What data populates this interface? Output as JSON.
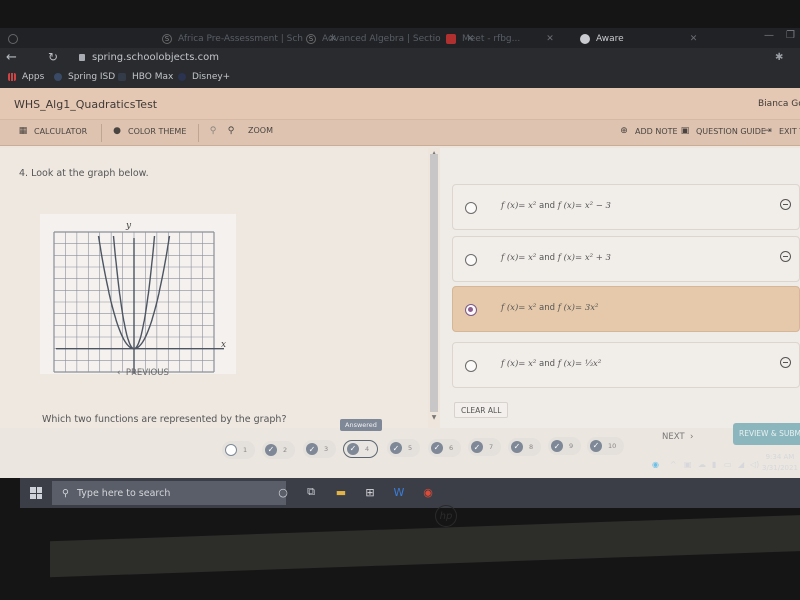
{
  "browser": {
    "tabs": [
      {
        "label": "Africa Pre-Assessment | Sch",
        "icon": "schoolobjects-icon",
        "active": false
      },
      {
        "label": "Advanced Algebra | Sectio",
        "icon": "schoolobjects-icon",
        "active": false
      },
      {
        "label": "Meet - rfbg...",
        "icon": "meet-icon",
        "active": false
      },
      {
        "label": "Aware",
        "icon": "globe-icon",
        "active": true
      }
    ],
    "url": "spring.schoolobjects.com",
    "bookmarks": [
      {
        "label": "Apps",
        "icon": "apps-grid-icon"
      },
      {
        "label": "Spring ISD",
        "icon": "bookmark-icon"
      },
      {
        "label": "HBO Max",
        "icon": "hbo-icon"
      },
      {
        "label": "Disney+",
        "icon": "disney-icon"
      }
    ]
  },
  "app": {
    "title": "WHS_Alg1_QuadraticsTest",
    "user": "Bianca Gon",
    "toolbar": {
      "calculator": "CALCULATOR",
      "color_theme": "COLOR THEME",
      "zoom": "ZOOM",
      "add_note": "ADD NOTE",
      "question_guide": "QUESTION GUIDE",
      "exit": "EXIT T"
    }
  },
  "question": {
    "title": "4. Look at the graph below.",
    "prompt": "Which two functions are represented by the graph?",
    "graph": {
      "x_label": "x",
      "y_label": "y"
    },
    "options": [
      {
        "f1": "f (x)= x²",
        "and": "and",
        "f2": "f (x)= x² − 3",
        "selected": false
      },
      {
        "f1": "f (x)= x²",
        "and": "and",
        "f2": "f (x)= x² + 3",
        "selected": false
      },
      {
        "f1": "f (x)= x²",
        "and": "and",
        "f2": "f (x)= 3x²",
        "selected": true
      },
      {
        "f1": "f (x)= x²",
        "and": "and",
        "f2": "f (x)= ⅓x²",
        "selected": false
      }
    ],
    "clear_all": "CLEAR ALL"
  },
  "navigation": {
    "previous": "PREVIOUS",
    "next": "NEXT",
    "review_submit": "REVIEW & SUBMI",
    "tooltip": "Answered",
    "current_question": 4,
    "questions": [
      {
        "n": "1",
        "answered": false
      },
      {
        "n": "2",
        "answered": true
      },
      {
        "n": "3",
        "answered": true
      },
      {
        "n": "4",
        "answered": true
      },
      {
        "n": "5",
        "answered": true
      },
      {
        "n": "6",
        "answered": true
      },
      {
        "n": "7",
        "answered": true
      },
      {
        "n": "8",
        "answered": true
      },
      {
        "n": "9",
        "answered": true
      },
      {
        "n": "10",
        "answered": true
      }
    ]
  },
  "taskbar": {
    "search_placeholder": "Type here to search",
    "time": "9:34 AM",
    "date": "3/31/2021"
  },
  "colors": {
    "header": "#e5c8b4",
    "selected_option": "#e6c9aa",
    "review_button": "#8cb6bd",
    "answered_check": "#7f8897"
  }
}
